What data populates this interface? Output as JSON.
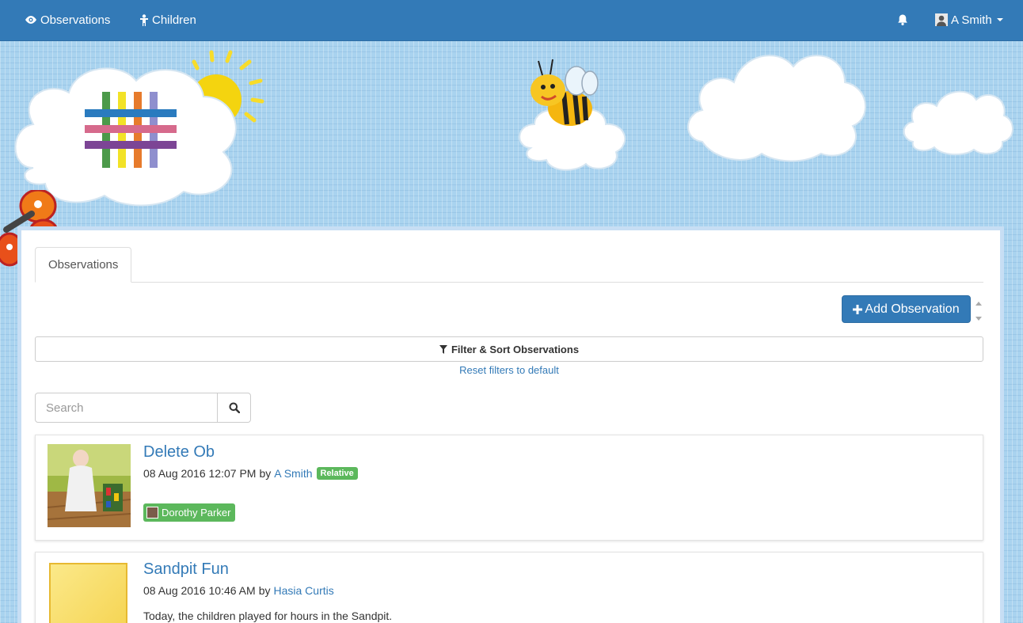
{
  "navbar": {
    "observations_label": "Observations",
    "children_label": "Children",
    "user_name": "A Smith"
  },
  "tabs": {
    "active_label": "Observations"
  },
  "toolbar": {
    "add_label": "Add Observation"
  },
  "filter": {
    "label": "Filter & Sort Observations",
    "reset_label": "Reset filters to default"
  },
  "search": {
    "placeholder": "Search",
    "value": ""
  },
  "observations": [
    {
      "title": "Delete Ob",
      "date": "08 Aug 2016 12:07 PM",
      "by": "by",
      "author": "A Smith",
      "author_role": "Relative",
      "child_tag": "Dorothy Parker"
    },
    {
      "title": "Sandpit Fun",
      "date": "08 Aug 2016 10:46 AM",
      "by": "by",
      "author": "Hasia Curtis",
      "description": "Today, the children played for hours in the Sandpit."
    }
  ],
  "colors": {
    "brand": "#337ab7",
    "success": "#5cb85c",
    "sky": "#a9d3ef"
  },
  "icons": [
    "eye-icon",
    "child-icon",
    "bell-icon",
    "user-icon",
    "plus-icon",
    "filter-icon",
    "search-icon"
  ]
}
